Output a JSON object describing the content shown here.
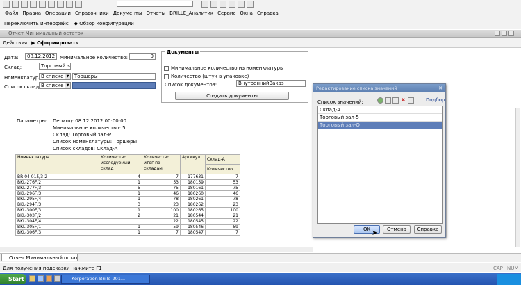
{
  "menu": {
    "items": [
      "Файл",
      "Правка",
      "Операции",
      "Справочники",
      "Документы",
      "Отчеты",
      "BRILLE_Аналитик",
      "Сервис",
      "Окна",
      "Справка"
    ]
  },
  "toolbar": {
    "switch_interface": "Переключить интерфейс",
    "config_overview": "Обзор конфигурации"
  },
  "window": {
    "title": "Отчет  Минимальный остаток"
  },
  "form_toolbar": {
    "actions": "Действия",
    "generate": "Сформировать"
  },
  "form": {
    "date_label": "Дата:",
    "date_value": "08.12.2012",
    "min_qty_label": "Минимальное количество:",
    "min_qty_value": "0",
    "warehouse_label": "Склад:",
    "warehouse_value": "Торговый зал-Р",
    "nomenclature_label": "Номенклатура:",
    "nomenclature_mode": "В списке",
    "nomenclature_value": "Торшеры",
    "warehouses_list_label": "Список складов:",
    "warehouses_list_mode": "В списке"
  },
  "documents_group": {
    "title": "Документы",
    "check_min_qty": "Минимальное количество из номенклатуры",
    "check_qty_pack": "Количество (штук в упаковке)",
    "doc_list_label": "Список документов:",
    "doc_list_value": "ВнутреннийЗаказ",
    "create_docs": "Создать документы"
  },
  "report": {
    "params_label": "Параметры:",
    "params": [
      "Период: 08.12.2012 00:00:00",
      "Минимальное количество: 5",
      "Склад: Торговый зал-Р",
      "Список номенклатуры: Торшеры",
      "Список складов: Склад-А"
    ],
    "headers": {
      "nomenclature": "Номенклатура",
      "qty_wh1": "Количество",
      "qty_wh2": "исследуемый",
      "qty_wh3": "склад",
      "qty_total1": "Количество",
      "qty_total2": "итог по",
      "qty_total3": "складам",
      "article": "Артикул",
      "wh_a": "Склад-А",
      "qty": "Количество"
    },
    "rows": [
      [
        "BR-04 015/3-2",
        "4",
        "7",
        "177631",
        "7"
      ],
      [
        "BKL-276F/2",
        "1",
        "53",
        "180159",
        "53"
      ],
      [
        "BKL-277F/3",
        "5",
        "75",
        "180161",
        "75"
      ],
      [
        "BKL-296F/3",
        "1",
        "46",
        "180260",
        "46"
      ],
      [
        "BKL-295F/4",
        "1",
        "78",
        "180261",
        "78"
      ],
      [
        "BKL-294F/3",
        "3",
        "23",
        "180262",
        "23"
      ],
      [
        "BKL-300F/3",
        "1",
        "100",
        "180265",
        "100"
      ],
      [
        "BKL-303F/2",
        "2",
        "21",
        "180544",
        "21"
      ],
      [
        "BKL-304F/4",
        "",
        "22",
        "180545",
        "22"
      ],
      [
        "BKL-305F/1",
        "1",
        "59",
        "180546",
        "59"
      ],
      [
        "BKL-306F/3",
        "1",
        "7",
        "180547",
        "7"
      ]
    ]
  },
  "dialog": {
    "title": "Редактирование списка значений",
    "list_label": "Список значений:",
    "pick": "Подбор",
    "items": [
      "Склад-А",
      "Торговый зал-5",
      "Торговый зал-О"
    ],
    "ok": "OK",
    "cancel": "Отмена",
    "help": "Справка"
  },
  "bottom": {
    "tab": "Отчет  Минимальный остат...",
    "status": "Для получения подсказки нажмите F1",
    "cap": "CAP",
    "num": "NUM"
  },
  "taskbar": {
    "start": "Start",
    "app": "Korporation Brille 201..."
  }
}
